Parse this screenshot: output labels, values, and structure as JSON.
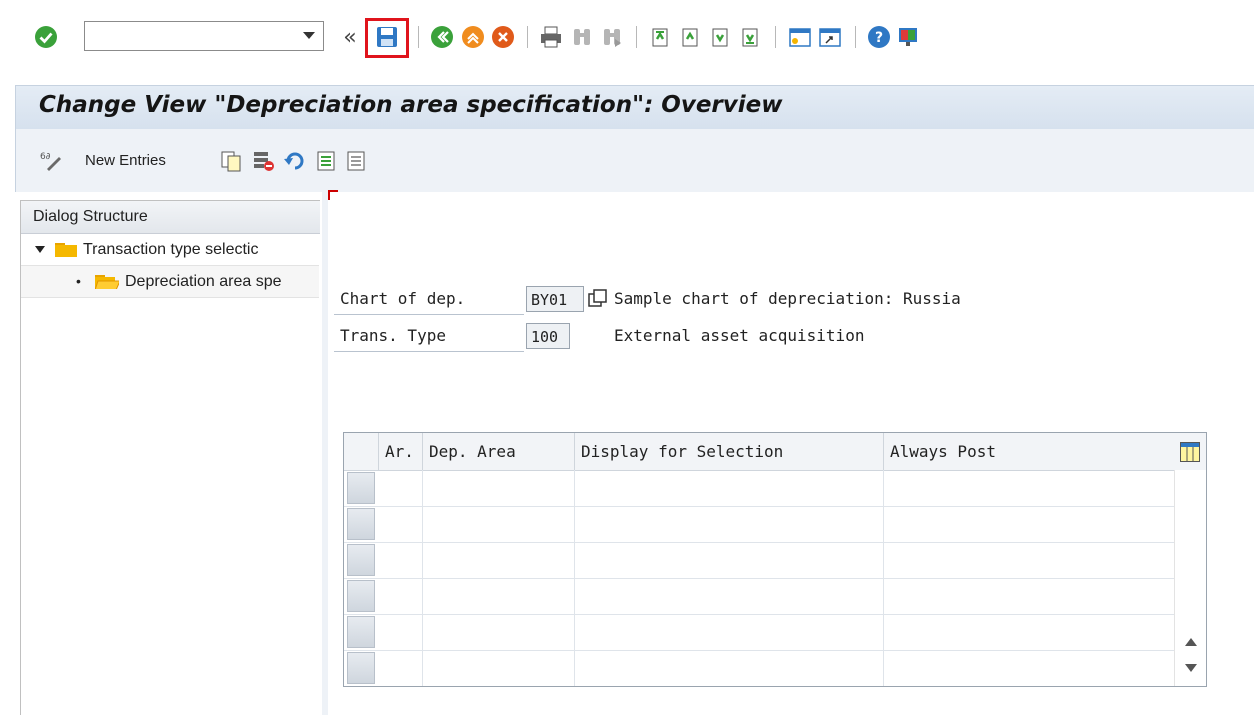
{
  "toolbar": {
    "command_field_value": "",
    "nav_back_symbol": "«",
    "icons": [
      "enter-icon",
      "save-icon",
      "back-icon",
      "exit-icon",
      "cancel-icon",
      "print-icon",
      "find-icon",
      "find-next-icon",
      "first-page-icon",
      "previous-page-icon",
      "next-page-icon",
      "last-page-icon",
      "create-session-icon",
      "shortcut-icon",
      "help-icon",
      "customize-layout-icon"
    ]
  },
  "title": "Change View \"Depreciation area specification\": Overview",
  "app_toolbar": {
    "new_entries_label": "New Entries"
  },
  "dialog_structure": {
    "header": "Dialog Structure",
    "items": [
      {
        "label": "Transaction type selectic"
      },
      {
        "label": "Depreciation area spe"
      }
    ]
  },
  "form": {
    "chart_label": "Chart of dep.",
    "chart_value": "BY01",
    "chart_desc": "Sample chart of depreciation: Russia",
    "trans_label": "Trans. Type",
    "trans_value": "100",
    "trans_desc": "External asset acquisition"
  },
  "table": {
    "columns": [
      "Ar.",
      "Dep. Area",
      "Display for Selection",
      "Always Post"
    ],
    "rows": [
      [],
      [],
      [],
      [],
      [],
      []
    ]
  },
  "colors": {
    "accent_highlight": "#e0141c",
    "title_bar": "#dbe4ef",
    "enter_green": "#3aa13a"
  }
}
